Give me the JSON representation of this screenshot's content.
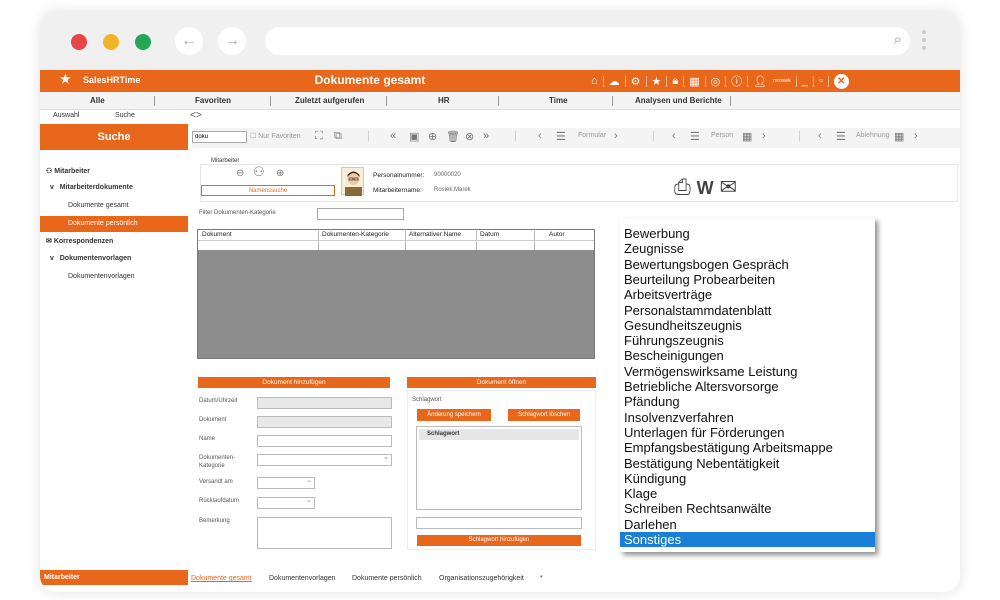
{
  "app": {
    "brand": "SalesHRTime",
    "title": "Dokumente gesamt",
    "user": "mrosiek"
  },
  "colors": {
    "accent": "#e8671b",
    "selection": "#1a7fd7",
    "grid_bg": "#8d8d8d"
  },
  "nav": {
    "items": [
      "Alle",
      "Favoriten",
      "Zuletzt aufgerufen",
      "HR",
      "Time",
      "Analysen und Berichte"
    ]
  },
  "subnav": {
    "auswahl": "Auswahl",
    "suche": "Suche",
    "arrows": "<>"
  },
  "sidebar": {
    "header": "Suche",
    "items": [
      {
        "label": "Mitarbeiter",
        "icon": "person-icon"
      },
      {
        "label": "Mitarbeiterdokumente",
        "prefix": "v"
      },
      {
        "label": "Dokumente gesamt"
      },
      {
        "label": "Dokumente persönlich"
      },
      {
        "label": "Korrespondenzen",
        "icon": "mail-icon"
      },
      {
        "label": "Dokumentenvorlagen",
        "prefix": "v"
      },
      {
        "label": "Dokumentenvorlagen"
      }
    ]
  },
  "toolbar": {
    "search_value": "doku",
    "only_favorites": "Nur Favoriten",
    "formular": "Formular",
    "person": "Person",
    "ablehnung": "Ablehnung"
  },
  "employee": {
    "section_label": "Mitarbeiter",
    "namesuche": "Namenssuche",
    "personalnummer_label": "Personalnummer:",
    "personalnummer": "90000020",
    "name_label": "Mitarbeitername:",
    "name": "Rosiek,Marek"
  },
  "filter": {
    "label": "Filter Dokumenten-Kategorie"
  },
  "grid": {
    "columns": [
      "Dokument",
      "Dokumenten-Kategorie",
      "Alternativer Name",
      "Datum",
      "Autor"
    ]
  },
  "add_doc": {
    "header": "Dokument hinzufügen",
    "labels": [
      "Datum/Uhrzeit",
      "Dokument",
      "Name",
      "Dokumenten-",
      "Kategorie",
      "Versandt am",
      "Rücklaufdatum",
      "Bemerkung"
    ]
  },
  "open_doc": {
    "header": "Dokument öffnen",
    "schlagwort_label": "Schlagwort",
    "save_btn": "Änderung speichern",
    "delete_btn": "Schlagwort löschen",
    "list_header": "Schlagwort",
    "add_btn": "Schlagwort hinzufügen"
  },
  "dropdown": {
    "options": [
      "Bewerbung",
      "Zeugnisse",
      "Bewertungsbogen Gespräch",
      "Beurteilung Probearbeiten",
      "Arbeitsverträge",
      "Personalstammdatenblatt",
      "Gesundheitszeugnis",
      "Führungszeugnis",
      "Bescheinigungen",
      "Vermögenswirksame Leistung",
      "Betriebliche Altersvorsorge",
      "Pfändung",
      "Insolvenzverfahren",
      "Unterlagen für Förderungen",
      "Empfangsbestätigung Arbeitsmappe",
      "Bestätigung Nebentätigkeit",
      "Kündigung",
      "Klage",
      "Schreiben Rechtsanwälte",
      "Darlehen",
      "Sonstiges"
    ],
    "selected": "Sonstiges"
  },
  "footer": {
    "sidebar_label": "Mitarbeiter",
    "tabs": [
      "Dokumente gesamt",
      "Dokumentenvorlagen",
      "Dokumente persönlich",
      "Organisationszugehörigkeit",
      "*"
    ]
  }
}
